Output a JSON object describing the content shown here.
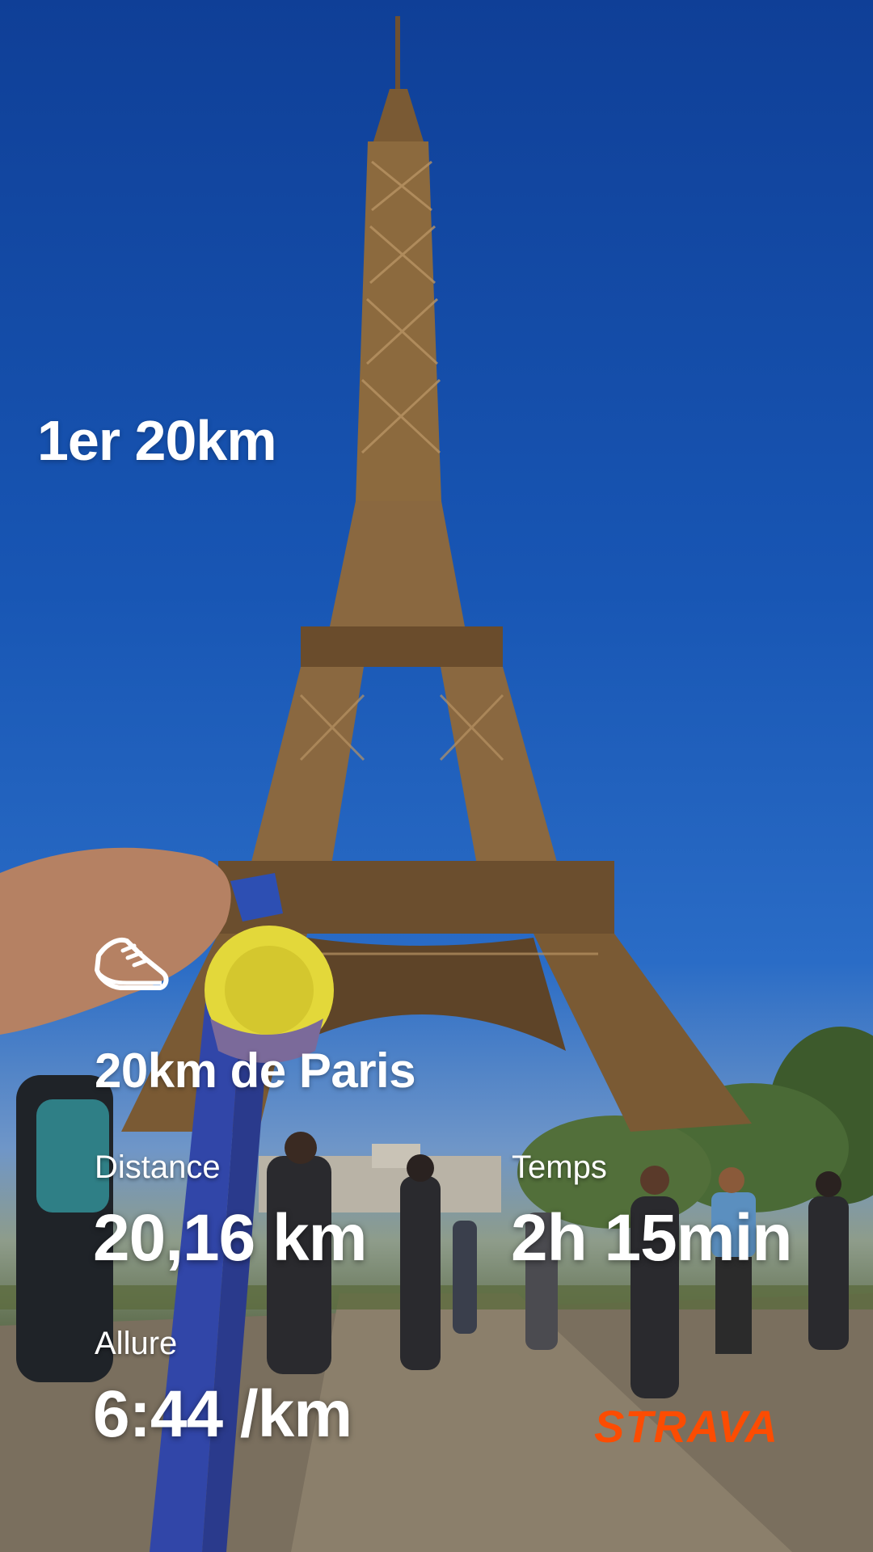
{
  "story": {
    "caption": "1er 20km",
    "activity_icon": "running-shoe-icon",
    "activity_name": "20km de Paris",
    "stats": [
      {
        "label": "Distance",
        "value": "20,16 km"
      },
      {
        "label": "Temps",
        "value": "2h 15min"
      },
      {
        "label": "Allure",
        "value": "6:44 /km"
      }
    ],
    "brand": "STRAVA",
    "brand_color": "#fc4c02"
  }
}
